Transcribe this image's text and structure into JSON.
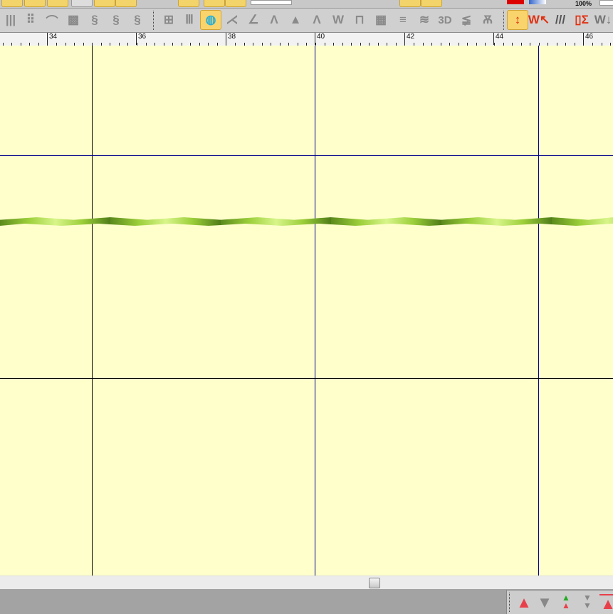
{
  "toolbar_top": {
    "zoom_label": "100%"
  },
  "toolbar_stitch": {
    "tools": [
      {
        "name": "satin-fill-tool"
      },
      {
        "name": "dot-fill-tool"
      },
      {
        "name": "arc-fill-tool"
      },
      {
        "name": "cross-fill-tool"
      },
      {
        "name": "motif-fill-tool"
      },
      {
        "name": "stipple-fill-tool"
      },
      {
        "name": "contour-fill-tool"
      },
      {
        "name": "grid-tool"
      },
      {
        "name": "column-tool"
      },
      {
        "name": "radial-fill-tool",
        "selected": true
      },
      {
        "name": "star-tool"
      },
      {
        "name": "fan-tool"
      },
      {
        "name": "peak-tool"
      },
      {
        "name": "peak2-tool"
      },
      {
        "name": "solid-peak-tool"
      },
      {
        "name": "zigzag-tool"
      },
      {
        "name": "square-wave-tool"
      },
      {
        "name": "pattern-tool"
      },
      {
        "name": "lines-tool"
      },
      {
        "name": "wave-tool"
      },
      {
        "name": "3d-tool",
        "label": "3D"
      },
      {
        "name": "curly-tool"
      },
      {
        "name": "ribbon-tool"
      }
    ],
    "right_tools": [
      {
        "name": "stitch-height-tool",
        "selected": true
      },
      {
        "name": "select-stitch-tool"
      },
      {
        "name": "stitch-spacing-tool"
      },
      {
        "name": "stitch-calc-tool"
      },
      {
        "name": "stitch-down-tool"
      }
    ]
  },
  "ruler": {
    "labels": [
      "34",
      "36",
      "38",
      "40",
      "42",
      "44",
      "46"
    ]
  },
  "bottom_toolbar": {
    "buttons": [
      "move-up",
      "move-down",
      "move-up-one",
      "move-down-one",
      "move-to-top"
    ]
  },
  "colors": {
    "canvas": "#ffffcc",
    "grid_major": "#00008b",
    "grid_minor": "#000000",
    "stitch": "#9ccf3a"
  }
}
